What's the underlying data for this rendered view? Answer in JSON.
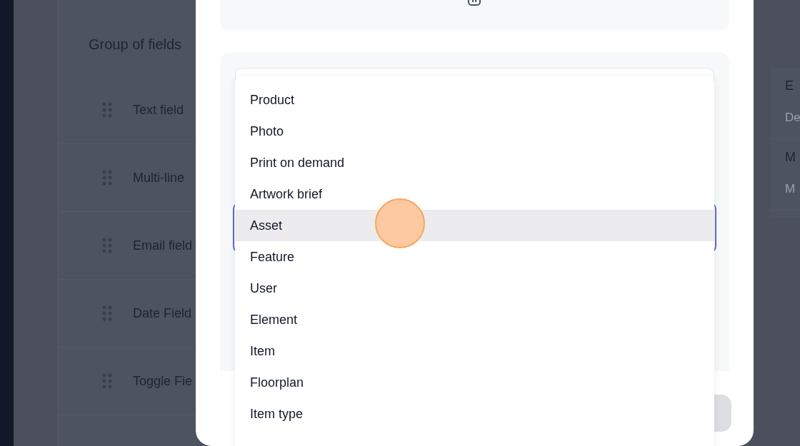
{
  "background": {
    "group_title": "Group of fields",
    "fields": [
      {
        "label": "Text field"
      },
      {
        "label": "Multi-line"
      },
      {
        "label": "Email field"
      },
      {
        "label": "Date Field"
      },
      {
        "label": "Toggle Fie"
      }
    ],
    "side_rows": [
      {
        "title": "E",
        "subtitle": "De"
      },
      {
        "title": "M",
        "subtitle": "M"
      }
    ]
  },
  "dropdown": {
    "options": [
      {
        "label": "Product",
        "selected": false
      },
      {
        "label": "Photo",
        "selected": false
      },
      {
        "label": "Print on demand",
        "selected": false
      },
      {
        "label": "Artwork brief",
        "selected": false
      },
      {
        "label": "Asset",
        "selected": true
      },
      {
        "label": "Feature",
        "selected": false
      },
      {
        "label": "User",
        "selected": false
      },
      {
        "label": "Element",
        "selected": false
      },
      {
        "label": "Item",
        "selected": false
      },
      {
        "label": "Floorplan",
        "selected": false
      },
      {
        "label": "Item type",
        "selected": false
      }
    ]
  }
}
